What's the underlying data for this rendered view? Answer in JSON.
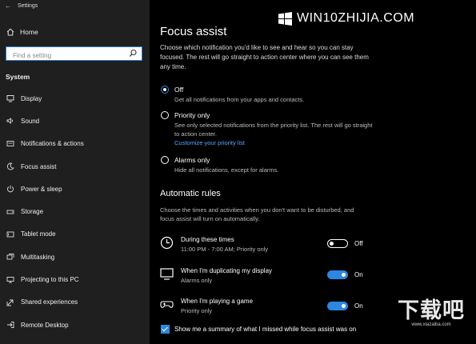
{
  "window": {
    "title": "Settings"
  },
  "sidebar": {
    "home_label": "Home",
    "search_placeholder": "Find a setting",
    "section_label": "System",
    "items": [
      {
        "label": "Display",
        "icon": "display-icon"
      },
      {
        "label": "Sound",
        "icon": "sound-icon"
      },
      {
        "label": "Notifications & actions",
        "icon": "notifications-icon"
      },
      {
        "label": "Focus assist",
        "icon": "moon-icon"
      },
      {
        "label": "Power & sleep",
        "icon": "power-icon"
      },
      {
        "label": "Storage",
        "icon": "storage-icon"
      },
      {
        "label": "Tablet mode",
        "icon": "tablet-icon"
      },
      {
        "label": "Multitasking",
        "icon": "multitasking-icon"
      },
      {
        "label": "Projecting to this PC",
        "icon": "projecting-icon"
      },
      {
        "label": "Shared experiences",
        "icon": "shared-icon"
      },
      {
        "label": "Remote Desktop",
        "icon": "remote-icon"
      }
    ]
  },
  "watermark": {
    "text": "WIN10ZHIJIA.COM",
    "bottom_big": "下载吧",
    "bottom_small": "www.xiazaiba.com"
  },
  "main": {
    "title": "Focus assist",
    "description": "Choose which notification you'd like to see and hear so you can stay focused. The rest will go straight to action center where you can see them any time.",
    "options": [
      {
        "label": "Off",
        "desc": "Get all notifications from your apps and contacts.",
        "selected": true
      },
      {
        "label": "Priority only",
        "desc": "See only selected notifications from the priority list. The rest will go straight to action center.",
        "link": "Customize your priority list",
        "selected": false
      },
      {
        "label": "Alarms only",
        "desc": "Hide all notifications, except for alarms.",
        "selected": false
      }
    ],
    "rules_title": "Automatic rules",
    "rules_desc": "Choose the times and activities when you don't want to be disturbed, and focus assist will turn on automatically.",
    "rules": [
      {
        "title": "During these times",
        "detail": "11:00 PM - 7:00 AM; Priority only",
        "state": "Off",
        "on": false,
        "icon": "clock-icon"
      },
      {
        "title": "When I'm duplicating my display",
        "detail": "Alarms only",
        "state": "On",
        "on": true,
        "icon": "monitor-icon"
      },
      {
        "title": "When I'm playing a game",
        "detail": "Priority only",
        "state": "On",
        "on": true,
        "icon": "gamepad-icon"
      }
    ],
    "summary_label": "Show me a summary of what I missed while focus assist was on",
    "summary_checked": true
  },
  "colors": {
    "accent": "#2d86e0",
    "sidebar_bg": "#1f1f1f",
    "main_bg": "#000000",
    "link": "#5aa8ff"
  }
}
